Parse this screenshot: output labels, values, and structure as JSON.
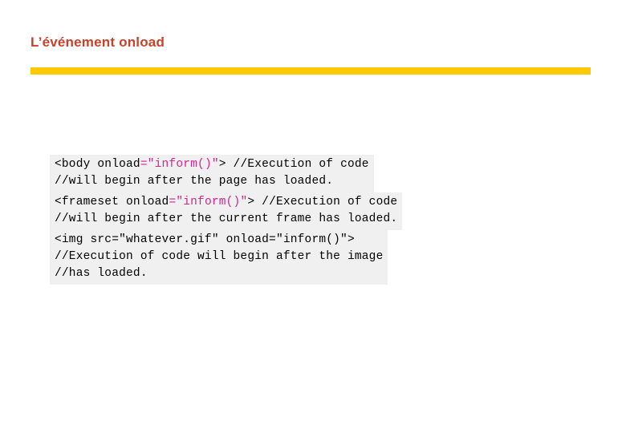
{
  "slide": {
    "title": "L’événement onload",
    "accent_color": "#c8422a",
    "rule_color": "#fdc907",
    "background_color": "#ffffff",
    "code_background_color": "#f0f0f0",
    "code_text_color": "#000000",
    "code_attribute_color": "#d4268c"
  },
  "code_blocks": [
    {
      "name": "body-onload-example",
      "lines": [
        {
          "segments": [
            {
              "text": "<body onload",
              "kind": "plain"
            },
            {
              "text": "=\"inform()\"",
              "kind": "attr"
            },
            {
              "text": "> //Execution of code",
              "kind": "plain"
            }
          ],
          "plain": "<body onload=\"inform()\"> //Execution of code"
        },
        {
          "segments": [
            {
              "text": "//will begin after the page has loaded.",
              "kind": "plain"
            }
          ],
          "plain": "//will begin after the page has loaded."
        }
      ]
    },
    {
      "name": "frameset-onload-example",
      "lines": [
        {
          "segments": [
            {
              "text": "<frameset onload",
              "kind": "plain"
            },
            {
              "text": "=\"inform()\"",
              "kind": "attr"
            },
            {
              "text": "> //Execution of code",
              "kind": "plain"
            }
          ],
          "plain": "<frameset onload=\"inform()\"> //Execution of code"
        },
        {
          "segments": [
            {
              "text": "//will begin after the current frame has loaded.",
              "kind": "plain"
            }
          ],
          "plain": "//will begin after the current frame has loaded."
        }
      ]
    },
    {
      "name": "img-onload-example",
      "lines": [
        {
          "segments": [
            {
              "text": "<img src=\"whatever.gif\" onload=\"inform()\">",
              "kind": "plain"
            }
          ],
          "plain": "<img src=\"whatever.gif\" onload=\"inform()\">"
        },
        {
          "segments": [
            {
              "text": "//Execution of code will begin after the image",
              "kind": "plain"
            }
          ],
          "plain": "//Execution of code will begin after the image"
        },
        {
          "segments": [
            {
              "text": "//has loaded.",
              "kind": "plain"
            }
          ],
          "plain": "//has loaded."
        }
      ]
    }
  ]
}
